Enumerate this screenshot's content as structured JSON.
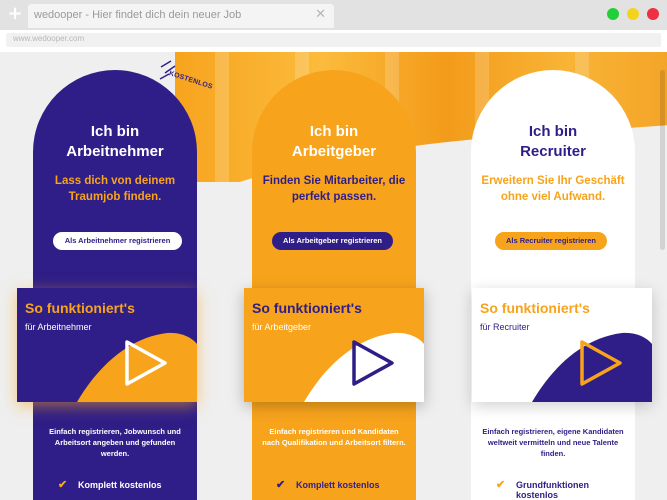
{
  "browser": {
    "tab_title": "wedooper - Hier findet dich dein neuer Job",
    "url": "www.wedooper.com",
    "new_tab_icon": "plus-icon",
    "close_icon": "close-icon"
  },
  "stamp": {
    "text": "KOSTENLOS"
  },
  "columns": [
    {
      "title_line1": "Ich bin",
      "title_line2": "Arbeitnehmer",
      "subtitle": "Lass dich von deinem Traumjob finden.",
      "button": "Als Arbeitnehmer registrieren",
      "card_title": "So funktioniert's",
      "card_sub": "für Arbeitnehmer",
      "description": "Einfach registrieren, Jobwunsch und Arbeitsort angeben und gefunden werden.",
      "feature": "Komplett kostenlos"
    },
    {
      "title_line1": "Ich bin",
      "title_line2": "Arbeitgeber",
      "subtitle": "Finden Sie Mitarbeiter, die perfekt passen.",
      "button": "Als Arbeitgeber registrieren",
      "card_title": "So funktioniert's",
      "card_sub": "für Arbeitgeber",
      "description": "Einfach registrieren und Kandidaten nach Qualifikation und Arbeitsort filtern.",
      "feature": "Komplett kostenlos"
    },
    {
      "title_line1": "Ich bin",
      "title_line2": "Recruiter",
      "subtitle": "Erweitern Sie Ihr Geschäft ohne viel Aufwand.",
      "button": "Als Recruiter registrieren",
      "card_title": "So funktioniert's",
      "card_sub": "für Recruiter",
      "description": "Einfach registrieren, eigene Kandidaten weltweit vermitteln und neue Talente finden.",
      "feature": "Grundfunktionen",
      "feature_line2": "kostenlos"
    }
  ],
  "colors": {
    "navy": "#2f1e87",
    "orange": "#f7a41c",
    "white": "#ffffff"
  }
}
